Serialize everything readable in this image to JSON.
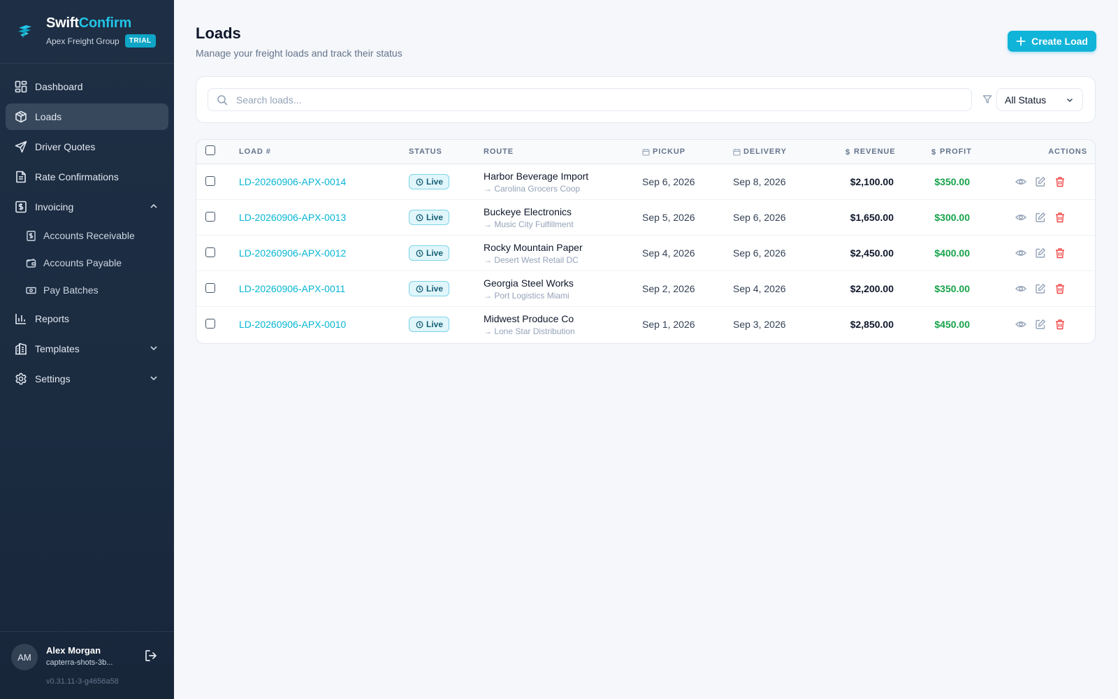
{
  "brand": {
    "name_part1": "Swift",
    "name_part2": "Confirm",
    "company": "Apex Freight Group",
    "badge": "TRIAL",
    "accent": "#22c3e6"
  },
  "sidebar": {
    "items": [
      {
        "label": "Dashboard",
        "icon": "grid-icon"
      },
      {
        "label": "Loads",
        "icon": "package-icon",
        "active": true
      },
      {
        "label": "Driver Quotes",
        "icon": "send-icon"
      },
      {
        "label": "Rate Confirmations",
        "icon": "document-icon"
      },
      {
        "label": "Invoicing",
        "icon": "invoice-icon",
        "expanded": true
      },
      {
        "label": "Reports",
        "icon": "bar-chart-icon"
      },
      {
        "label": "Templates",
        "icon": "building-icon",
        "expanded": false
      },
      {
        "label": "Settings",
        "icon": "gear-icon",
        "expanded": false
      }
    ],
    "invoicing_sub": [
      {
        "label": "Accounts Receivable",
        "icon": "receivable-icon"
      },
      {
        "label": "Accounts Payable",
        "icon": "wallet-icon"
      },
      {
        "label": "Pay Batches",
        "icon": "banknote-icon"
      }
    ]
  },
  "user": {
    "initials": "AM",
    "name": "Alex Morgan",
    "email": "capterra-shots-3b...",
    "version": "v0.31.11-3-g4656a58"
  },
  "header": {
    "title": "Loads",
    "subtitle": "Manage your freight loads and track their status",
    "create_label": "Create Load"
  },
  "filters": {
    "search_placeholder": "Search loads...",
    "status_value": "All Status"
  },
  "table": {
    "columns": {
      "load": "LOAD #",
      "status": "STATUS",
      "route": "ROUTE",
      "pickup": "PICKUP",
      "delivery": "DELIVERY",
      "revenue": "REVENUE",
      "profit": "PROFIT",
      "actions": "ACTIONS"
    },
    "rows": [
      {
        "id": "LD-20260906-APX-0014",
        "status": "Live",
        "route_from": "Harbor Beverage Import",
        "route_to": "→ Carolina Grocers Coop",
        "pickup": "Sep 6, 2026",
        "delivery": "Sep 8, 2026",
        "revenue": "$2,100.00",
        "profit": "$350.00"
      },
      {
        "id": "LD-20260906-APX-0013",
        "status": "Live",
        "route_from": "Buckeye Electronics",
        "route_to": "→ Music City Fulfillment",
        "pickup": "Sep 5, 2026",
        "delivery": "Sep 6, 2026",
        "revenue": "$1,650.00",
        "profit": "$300.00"
      },
      {
        "id": "LD-20260906-APX-0012",
        "status": "Live",
        "route_from": "Rocky Mountain Paper",
        "route_to": "→ Desert West Retail DC",
        "pickup": "Sep 4, 2026",
        "delivery": "Sep 6, 2026",
        "revenue": "$2,450.00",
        "profit": "$400.00"
      },
      {
        "id": "LD-20260906-APX-0011",
        "status": "Live",
        "route_from": "Georgia Steel Works",
        "route_to": "→ Port Logistics Miami",
        "pickup": "Sep 2, 2026",
        "delivery": "Sep 4, 2026",
        "revenue": "$2,200.00",
        "profit": "$350.00"
      },
      {
        "id": "LD-20260906-APX-0010",
        "status": "Live",
        "route_from": "Midwest Produce Co",
        "route_to": "→ Lone Star Distribution",
        "pickup": "Sep 1, 2026",
        "delivery": "Sep 3, 2026",
        "revenue": "$2,850.00",
        "profit": "$450.00"
      }
    ]
  },
  "colors": {
    "primary": "#10b4d8",
    "profit": "#16a34a",
    "delete": "#ef4444",
    "sidebar_bg": "#1e2e44"
  }
}
